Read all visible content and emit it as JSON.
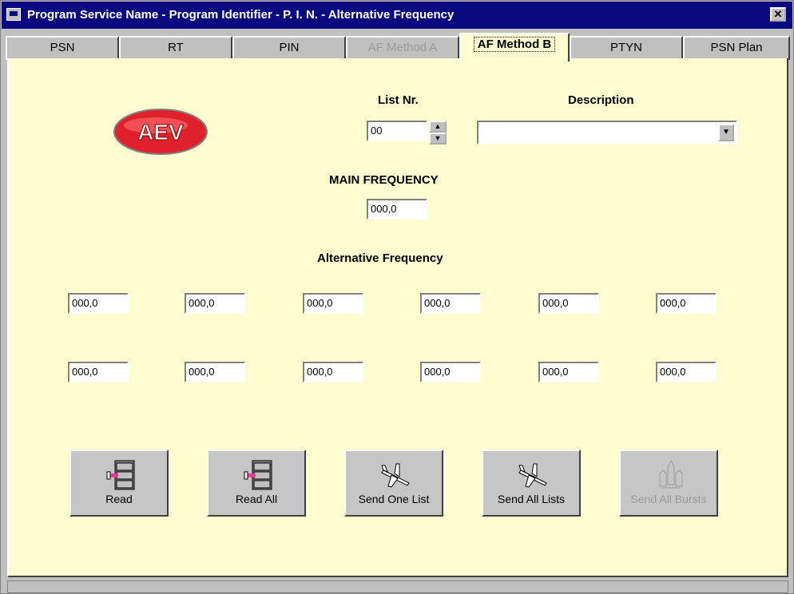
{
  "window": {
    "title": "Program Service Name - Program Identifier - P. I. N. - Alternative Frequency"
  },
  "tabs": [
    {
      "label": "PSN",
      "state": "normal"
    },
    {
      "label": "RT",
      "state": "normal"
    },
    {
      "label": "PIN",
      "state": "normal"
    },
    {
      "label": "AF Method A",
      "state": "disabled"
    },
    {
      "label": "AF Method B",
      "state": "active"
    },
    {
      "label": "PTYN",
      "state": "normal"
    },
    {
      "label": "PSN Plan",
      "state": "normal"
    }
  ],
  "logo": {
    "text": "AEV",
    "icon": "aev-logo-icon"
  },
  "list": {
    "label": "List Nr.",
    "value": "00"
  },
  "description": {
    "label": "Description",
    "value": ""
  },
  "main_frequency": {
    "label": "MAIN FREQUENCY",
    "value": "000,0"
  },
  "alternative_frequency": {
    "label": "Alternative Frequency",
    "row1": [
      "000,0",
      "000,0",
      "000,0",
      "000,0",
      "000,0",
      "000,0"
    ],
    "row2": [
      "000,0",
      "000,0",
      "000,0",
      "000,0",
      "000,0",
      "000,0"
    ]
  },
  "buttons": [
    {
      "label": "Read",
      "icon": "file-cabinet-icon",
      "enabled": true
    },
    {
      "label": "Read All",
      "icon": "file-cabinet-icon",
      "enabled": true
    },
    {
      "label": "Send One List",
      "icon": "airplane-icon",
      "enabled": true
    },
    {
      "label": "Send All Lists",
      "icon": "airplane-icon",
      "enabled": true
    },
    {
      "label": "Send All Bursts",
      "icon": "space-shuttle-icon",
      "enabled": false
    }
  ],
  "colors": {
    "panel_bg": "#fffdcf",
    "titlebar": "#0a0a80",
    "logo_red": "#e0202a"
  }
}
